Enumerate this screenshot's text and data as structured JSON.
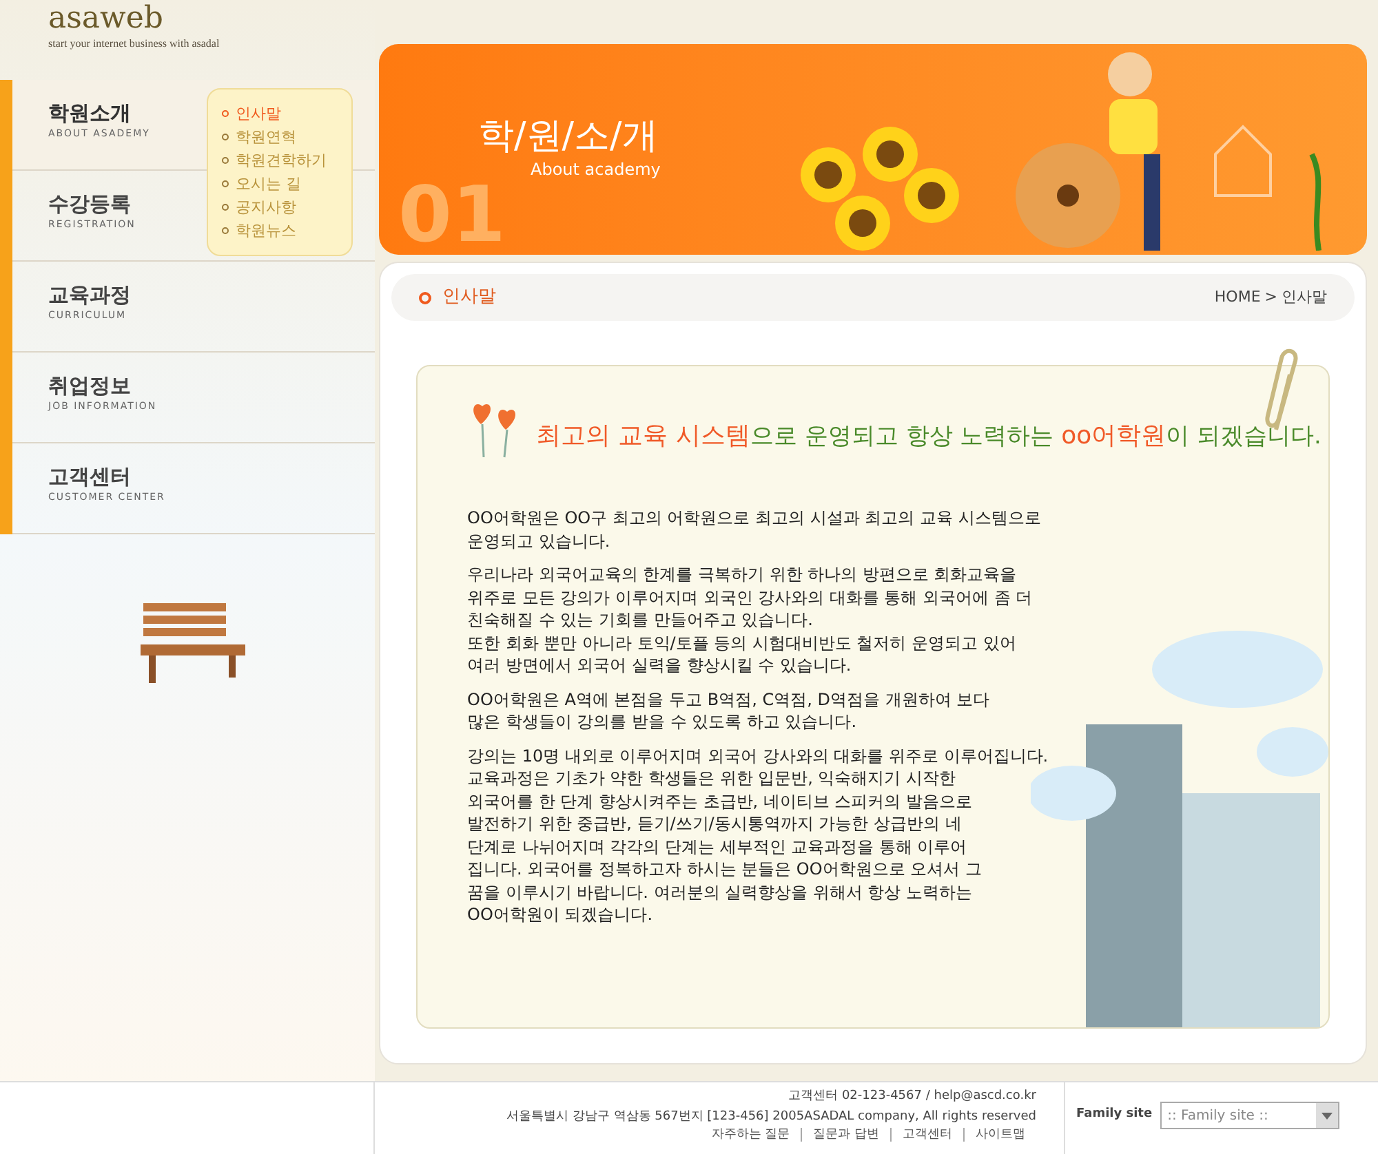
{
  "header": {
    "logo": "asaweb",
    "tagline": "start your internet business with asadal"
  },
  "sidebar": {
    "items": [
      {
        "title": "학원소개",
        "subtitle": "ABOUT ASADEMY",
        "selected": true
      },
      {
        "title": "수강등록",
        "subtitle": "REGISTRATION",
        "selected": false
      },
      {
        "title": "교육과정",
        "subtitle": "CURRICULUM",
        "selected": false
      },
      {
        "title": "취업정보",
        "subtitle": "JOB INFORMATION",
        "selected": false
      },
      {
        "title": "고객센터",
        "subtitle": "CUSTOMER CENTER",
        "selected": false
      }
    ],
    "submenu": [
      {
        "label": "인사말",
        "selected": true
      },
      {
        "label": "학원연혁",
        "selected": false
      },
      {
        "label": "학원견학하기",
        "selected": false
      },
      {
        "label": "오시는 길",
        "selected": false
      },
      {
        "label": "공지사항",
        "selected": false
      },
      {
        "label": "학원뉴스",
        "selected": false
      }
    ]
  },
  "banner": {
    "title": "학/원/소/개",
    "subtitle": "About academy",
    "number": "01"
  },
  "page": {
    "title": "인사말",
    "breadcrumb": [
      "HOME",
      ">",
      "인사말"
    ]
  },
  "headline": [
    {
      "text": "최고의 교육 시스템",
      "emphasis": true
    },
    {
      "text": "으로 운영되고 항상 노력하는 ",
      "emphasis": false
    },
    {
      "text": "oo어학원",
      "emphasis": true
    },
    {
      "text": "이 되겠습니다.",
      "emphasis": false
    }
  ],
  "paragraphs": [
    [
      "OO어학원은 OO구 최고의 어학원으로 최고의 시설과 최고의 교육 시스템으로",
      "운영되고 있습니다."
    ],
    [
      "우리나라 외국어교육의 한계를 극복하기 위한 하나의 방편으로 회화교육을",
      "위주로 모든 강의가 이루어지며 외국인 강사와의 대화를 통해 외국어에 좀 더",
      "친숙해질 수 있는 기회를 만들어주고 있습니다.",
      "또한 회화 뿐만 아니라 토익/토플 등의 시험대비반도 철저히 운영되고 있어",
      "여러 방면에서 외국어 실력을 향상시킬 수 있습니다."
    ],
    [
      "OO어학원은 A역에 본점을 두고 B역점, C역점, D역점을 개원하여 보다",
      "많은 학생들이 강의를 받을 수 있도록 하고 있습니다."
    ],
    [
      "강의는 10명 내외로 이루어지며 외국어 강사와의 대화를 위주로 이루어집니다.",
      "교육과정은 기초가 약한 학생들은 위한 입문반, 익숙해지기 시작한",
      "외국어를 한 단계 향상시켜주는 초급반, 네이티브 스피커의 발음으로",
      "발전하기 위한 중급반, 듣기/쓰기/동시통역까지 가능한 상급반의 네",
      "단계로 나뉘어지며 각각의 단계는 세부적인 교육과정을 통해 이루어",
      "집니다. 외국어를 정복하고자 하시는 분들은 OO어학원으로 오셔서 그",
      "꿈을 이루시기 바랍니다. 여러분의 실력향상을 위해서 항상 노력하는",
      "OO어학원이 되겠습니다."
    ]
  ],
  "footer": {
    "contact": "고객센터 02-123-4567 / help@ascd.co.kr",
    "address": "서울특별시 강남구 역삼동 567번지 [123-456] 2005ASADAL company, All rights reserved",
    "links": [
      "자주하는 질문",
      "질문과 답변",
      "고객센터",
      "사이트맵"
    ],
    "family_label": "Family site",
    "family_select": ":: Family site ::"
  }
}
